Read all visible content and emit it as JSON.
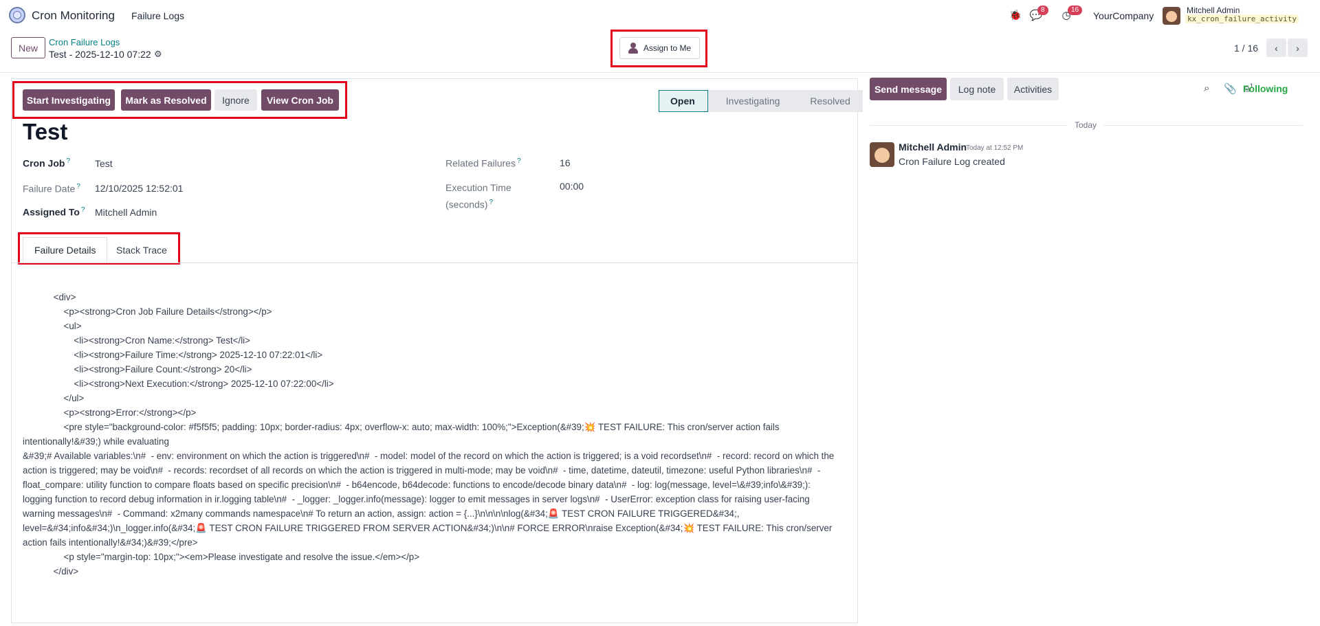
{
  "navbar": {
    "app_name": "Cron Monitoring",
    "menu_item": "Failure Logs",
    "messages_count": "8",
    "activities_count": "16",
    "company": "YourCompany",
    "user_name": "Mitchell Admin",
    "db_name": "kx_cron_failure_activity"
  },
  "control": {
    "new_label": "New",
    "breadcrumb": "Cron Failure Logs",
    "record_name": "Test - 2025-12-10 07:22",
    "assign_label": "Assign to Me",
    "pager": "1 / 16"
  },
  "actions": {
    "start": "Start Investigating",
    "resolve": "Mark as Resolved",
    "ignore": "Ignore",
    "view_cron": "View Cron Job"
  },
  "status": {
    "stages": [
      "Open",
      "Investigating",
      "Resolved"
    ],
    "active": "Open"
  },
  "form": {
    "title": "Test",
    "cron_job_label": "Cron Job",
    "cron_job_value": "Test",
    "failure_date_label": "Failure Date",
    "failure_date_value": "12/10/2025 12:52:01",
    "assigned_to_label": "Assigned To",
    "assigned_to_value": "Mitchell Admin",
    "related_failures_label": "Related Failures",
    "related_failures_value": "16",
    "exec_time_label_1": "Execution Time",
    "exec_time_label_2": "(seconds)",
    "exec_time_value": "00:00",
    "help_mark": "?"
  },
  "tabs": {
    "details": "Failure Details",
    "trace": "Stack Trace"
  },
  "details_html": "            <div>\n                <p><strong>Cron Job Failure Details</strong></p>\n                <ul>\n                    <li><strong>Cron Name:</strong> Test</li>\n                    <li><strong>Failure Time:</strong> 2025-12-10 07:22:01</li>\n                    <li><strong>Failure Count:</strong> 20</li>\n                    <li><strong>Next Execution:</strong> 2025-12-10 07:22:00</li>\n                </ul>\n                <p><strong>Error:</strong></p>\n                <pre style=\"background-color: #f5f5f5; padding: 10px; border-radius: 4px; overflow-x: auto; max-width: 100%;\">Exception(&#39;💥 TEST FAILURE: This cron/server action fails intentionally!&#39;) while evaluating\n&#39;# Available variables:\\n#  - env: environment on which the action is triggered\\n#  - model: model of the record on which the action is triggered; is a void recordset\\n#  - record: record on which the action is triggered; may be void\\n#  - records: recordset of all records on which the action is triggered in multi-mode; may be void\\n#  - time, datetime, dateutil, timezone: useful Python libraries\\n#  - float_compare: utility function to compare floats based on specific precision\\n#  - b64encode, b64decode: functions to encode/decode binary data\\n#  - log: log(message, level=\\&#39;info\\&#39;): logging function to record debug information in ir.logging table\\n#  - _logger: _logger.info(message): logger to emit messages in server logs\\n#  - UserError: exception class for raising user-facing warning messages\\n#  - Command: x2many commands namespace\\n# To return an action, assign: action = {...}\\n\\n\\n\\nlog(&#34;🚨 TEST CRON FAILURE TRIGGERED&#34;, level=&#34;info&#34;)\\n_logger.info(&#34;🚨 TEST CRON FAILURE TRIGGERED FROM SERVER ACTION&#34;)\\n\\n# FORCE ERROR\\nraise Exception(&#34;💥 TEST FAILURE: This cron/server action fails intentionally!&#34;)&#39;</pre>\n                <p style=\"margin-top: 10px;\"><em>Please investigate and resolve the issue.</em></p>\n            </div>",
  "chatter": {
    "send_message": "Send message",
    "log_note": "Log note",
    "activities": "Activities",
    "followers_count": "1",
    "following": "Following",
    "today": "Today",
    "author": "Mitchell Admin",
    "time": "Today at 12:52 PM",
    "body": "Cron Failure Log created"
  },
  "colors": {
    "brand": "#714b67",
    "accent": "#017e84",
    "highlight": "#e3001b"
  }
}
